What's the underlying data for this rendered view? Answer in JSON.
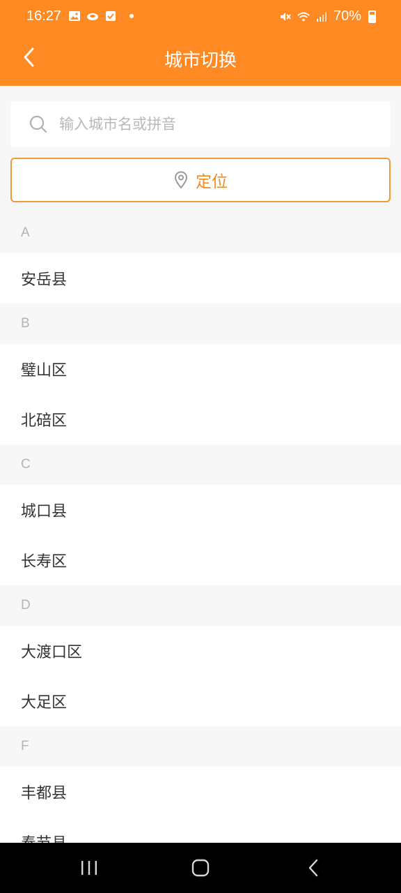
{
  "status": {
    "time": "16:27",
    "battery": "70%"
  },
  "header": {
    "title": "城市切换"
  },
  "search": {
    "placeholder": "输入城市名或拼音"
  },
  "locate": {
    "label": "定位"
  },
  "sections": [
    {
      "letter": "A",
      "cities": [
        "安岳县"
      ]
    },
    {
      "letter": "B",
      "cities": [
        "璧山区",
        "北碚区"
      ]
    },
    {
      "letter": "C",
      "cities": [
        "城口县",
        "长寿区"
      ]
    },
    {
      "letter": "D",
      "cities": [
        "大渡口区",
        "大足区"
      ]
    },
    {
      "letter": "F",
      "cities": [
        "丰都县",
        "奉节县"
      ]
    }
  ],
  "colors": {
    "accent": "#ff8a24",
    "section_bg": "#f7f7f8",
    "locate_border": "#ef9a3a"
  }
}
